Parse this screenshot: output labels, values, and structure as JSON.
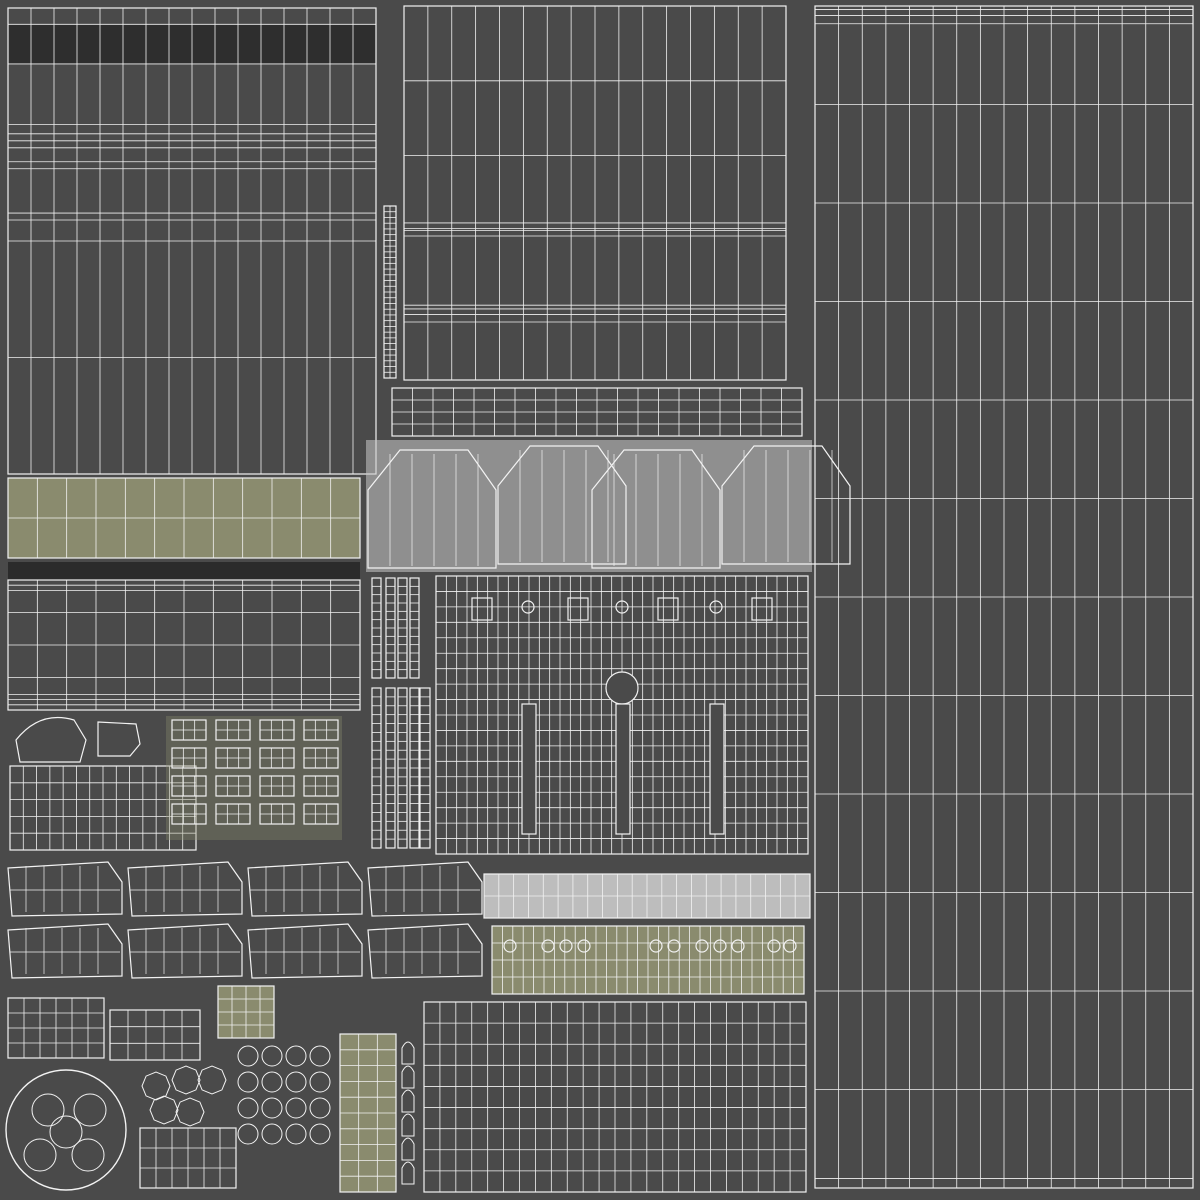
{
  "texture": {
    "background_color": "#4a4a4a",
    "wire_color": "#f2f2f2",
    "dark_patch_color": "#555555",
    "concrete_color": "#8f8f8f",
    "olive_color": "#8a8b6e",
    "light_concrete_color": "#c8c8c8"
  }
}
